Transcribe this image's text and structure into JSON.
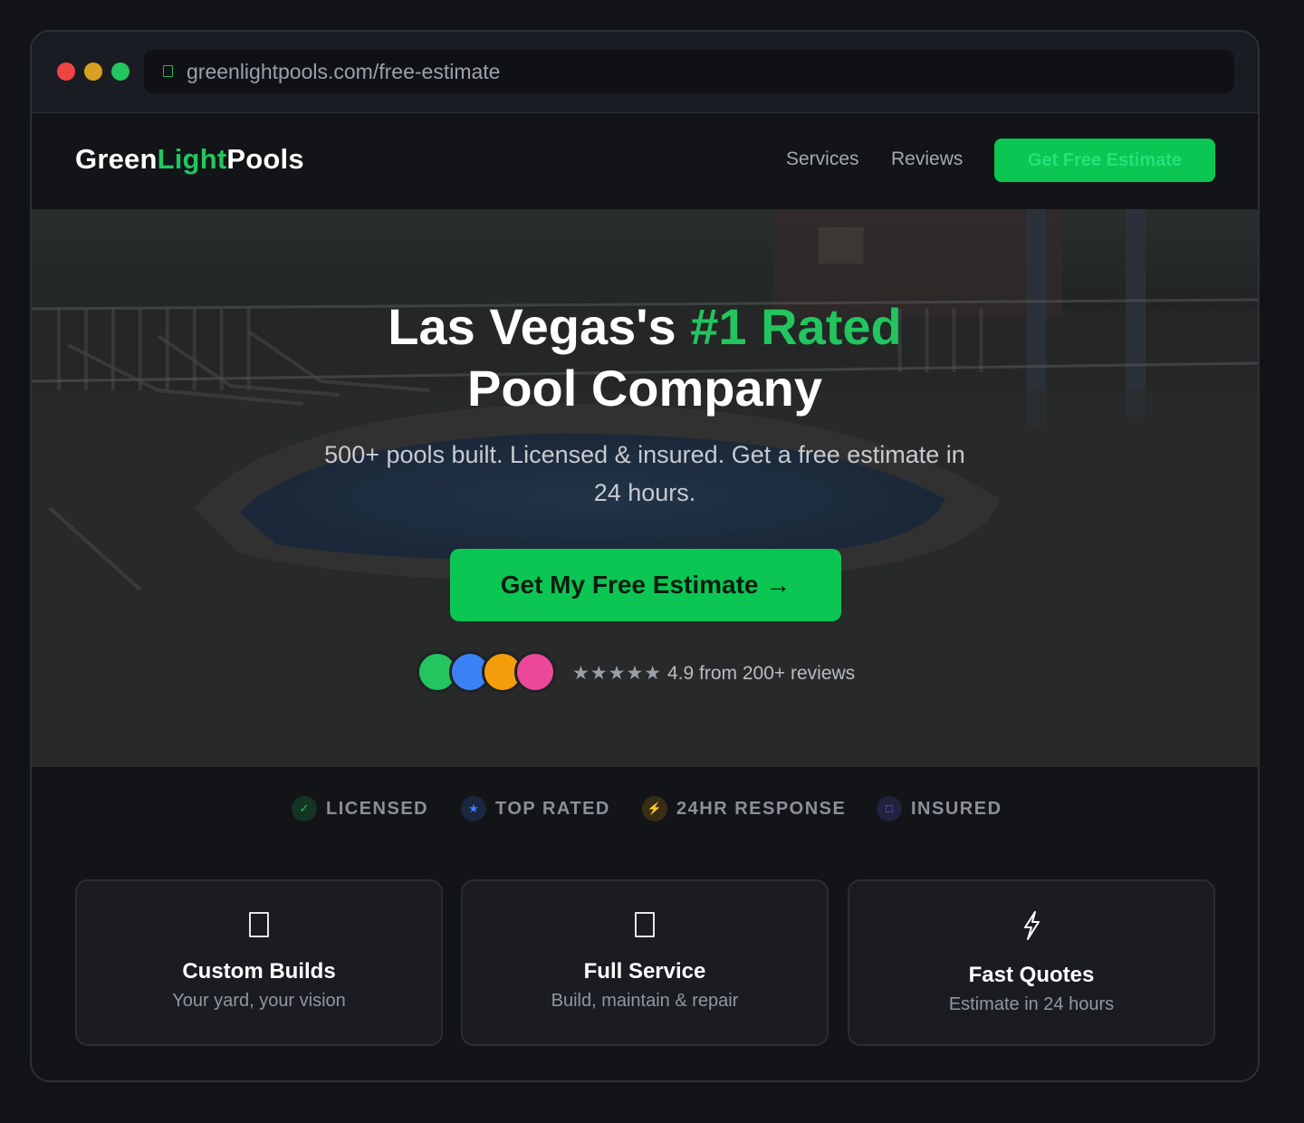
{
  "browser": {
    "url": "greenlightpools.com/free-estimate",
    "lock_icon": "lock-icon"
  },
  "nav": {
    "logo": {
      "part1": "Green",
      "part2": "Light",
      "part3": "Pools"
    },
    "links": [
      "Services",
      "Reviews"
    ],
    "cta": "Get Free Estimate"
  },
  "hero": {
    "title_part1": "Las Vegas's ",
    "title_highlight": "#1 Rated",
    "title_line2": "Pool Company",
    "subtitle_line1": "500+ pools built. Licensed & insured. Get a free estimate in",
    "subtitle_line2": "24 hours.",
    "cta": "Get My Free Estimate →",
    "avatar_colors": [
      "#22c55e",
      "#3b82f6",
      "#f59e0b",
      "#ec4899"
    ],
    "stars": "★★★★★",
    "rating_text": "4.9 from 200+ reviews"
  },
  "trust_badges": [
    {
      "icon": "check-icon",
      "glyph": "✓",
      "label": "LICENSED",
      "color": "#22c55e"
    },
    {
      "icon": "star-icon",
      "glyph": "★",
      "label": "TOP RATED",
      "color": "#3b82f6"
    },
    {
      "icon": "lightning-icon",
      "glyph": "⚡",
      "label": "24HR RESPONSE",
      "color": "#f59e0b"
    },
    {
      "icon": "shield-icon",
      "glyph": "□",
      "label": "INSURED",
      "color": "#6366f1"
    }
  ],
  "features": [
    {
      "icon": "box-icon",
      "title": "Custom Builds",
      "desc": "Your yard, your vision"
    },
    {
      "icon": "box-icon",
      "title": "Full Service",
      "desc": "Build, maintain & repair"
    },
    {
      "icon": "lightning-icon",
      "glyph": "⚡",
      "title": "Fast Quotes",
      "desc": "Estimate in 24 hours"
    }
  ],
  "colors": {
    "accent": "#22c55e",
    "cta_bg": "#0cc653",
    "page_bg": "#111317"
  }
}
